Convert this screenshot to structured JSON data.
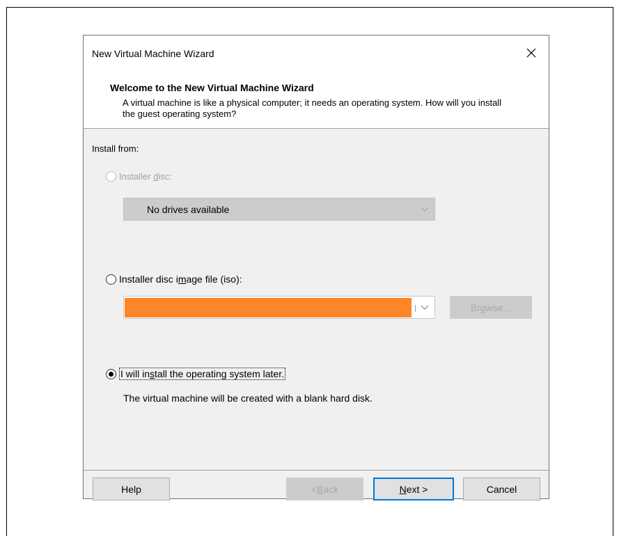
{
  "dialog": {
    "title": "New Virtual Machine Wizard",
    "header_title": "Welcome to the New Virtual Machine Wizard",
    "header_desc": "A virtual machine is like a physical computer; it needs an operating system. How will you install the guest operating system?",
    "section_label": "Install from:",
    "option_disc": {
      "pre": "Installer ",
      "accel": "d",
      "post": "isc:",
      "selected": false,
      "enabled": false
    },
    "disc_combo_value": "No drives available",
    "option_iso": {
      "pre": "Installer disc i",
      "accel": "m",
      "post": "age file (iso):",
      "selected": false,
      "enabled": true
    },
    "iso_value": "",
    "browse": {
      "pre": "Br",
      "accel": "o",
      "post": "wse...",
      "enabled": false
    },
    "option_later": {
      "pre": "I will in",
      "accel": "s",
      "post": "tall the operating system later.",
      "selected": true
    },
    "later_note": "The virtual machine will be created with a blank hard disk.",
    "buttons": {
      "help": "Help",
      "back": {
        "pre": "< ",
        "accel": "B",
        "post": "ack",
        "enabled": false
      },
      "next": {
        "pre": "",
        "accel": "N",
        "post": "ext >",
        "default": true
      },
      "cancel": "Cancel"
    }
  },
  "colors": {
    "iso_highlight": "#fd8628",
    "focus_border": "#0078d7"
  },
  "icons": {
    "close": "close-icon",
    "dropdown": "chevron-down-icon"
  }
}
